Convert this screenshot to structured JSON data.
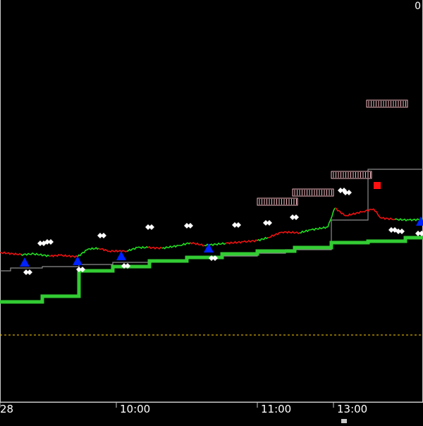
{
  "chart_data": {
    "type": "line",
    "title": "",
    "xlabel": "",
    "ylabel": "",
    "x_ticks": [
      "28",
      "10:00",
      "11:00",
      "13:00"
    ],
    "corner_text": "0",
    "background_color": "#000000",
    "frame_color": "#c8c8c8",
    "grid": false,
    "price_series": [
      {
        "x": 0,
        "y": 212,
        "dir": "down"
      },
      {
        "x": 30,
        "y": 209,
        "dir": "down"
      },
      {
        "x": 48,
        "y": 210,
        "dir": "up"
      },
      {
        "x": 70,
        "y": 207,
        "dir": "up"
      },
      {
        "x": 85,
        "y": 208,
        "dir": "down"
      },
      {
        "x": 110,
        "y": 206,
        "dir": "down"
      },
      {
        "x": 125,
        "y": 217,
        "dir": "up"
      },
      {
        "x": 140,
        "y": 218,
        "dir": "up"
      },
      {
        "x": 155,
        "y": 214,
        "dir": "down"
      },
      {
        "x": 180,
        "y": 214,
        "dir": "down"
      },
      {
        "x": 195,
        "y": 219,
        "dir": "up"
      },
      {
        "x": 210,
        "y": 219,
        "dir": "up"
      },
      {
        "x": 230,
        "y": 218,
        "dir": "down"
      },
      {
        "x": 255,
        "y": 222,
        "dir": "up"
      },
      {
        "x": 270,
        "y": 226,
        "dir": "up"
      },
      {
        "x": 290,
        "y": 222,
        "dir": "down"
      },
      {
        "x": 320,
        "y": 225,
        "dir": "up"
      },
      {
        "x": 345,
        "y": 227,
        "dir": "down"
      },
      {
        "x": 365,
        "y": 229,
        "dir": "down"
      },
      {
        "x": 380,
        "y": 233,
        "dir": "up"
      },
      {
        "x": 400,
        "y": 241,
        "dir": "down"
      },
      {
        "x": 425,
        "y": 240,
        "dir": "down"
      },
      {
        "x": 440,
        "y": 244,
        "dir": "up"
      },
      {
        "x": 465,
        "y": 248,
        "dir": "up"
      },
      {
        "x": 475,
        "y": 275,
        "dir": "up"
      },
      {
        "x": 490,
        "y": 264,
        "dir": "down"
      },
      {
        "x": 515,
        "y": 270,
        "dir": "down"
      },
      {
        "x": 530,
        "y": 274,
        "dir": "down"
      },
      {
        "x": 540,
        "y": 261,
        "dir": "down"
      },
      {
        "x": 560,
        "y": 259,
        "dir": "down"
      },
      {
        "x": 580,
        "y": 258,
        "dir": "up"
      },
      {
        "x": 600,
        "y": 259,
        "dir": "up"
      }
    ],
    "gray_step_series": [
      {
        "x": 0,
        "y": 186
      },
      {
        "x": 15,
        "y": 190
      },
      {
        "x": 60,
        "y": 192
      },
      {
        "x": 112,
        "y": 195
      },
      {
        "x": 160,
        "y": 198
      },
      {
        "x": 215,
        "y": 201
      },
      {
        "x": 265,
        "y": 205
      },
      {
        "x": 315,
        "y": 207
      },
      {
        "x": 365,
        "y": 211
      },
      {
        "x": 405,
        "y": 216
      },
      {
        "x": 470,
        "y": 258
      },
      {
        "x": 522,
        "y": 330
      },
      {
        "x": 575,
        "y": 330
      }
    ],
    "green_step_series": [
      {
        "x": 0,
        "y": 142
      },
      {
        "x": 60,
        "y": 150
      },
      {
        "x": 112,
        "y": 186
      },
      {
        "x": 160,
        "y": 192
      },
      {
        "x": 212,
        "y": 200
      },
      {
        "x": 265,
        "y": 205
      },
      {
        "x": 315,
        "y": 210
      },
      {
        "x": 365,
        "y": 214
      },
      {
        "x": 418,
        "y": 219
      },
      {
        "x": 470,
        "y": 226
      },
      {
        "x": 522,
        "y": 228
      },
      {
        "x": 575,
        "y": 233
      }
    ],
    "reference_line": {
      "y": 95,
      "color": "#ffd000",
      "style": "dashed"
    },
    "buy_markers": [
      {
        "x": 35,
        "y": 198
      },
      {
        "x": 110,
        "y": 200
      },
      {
        "x": 172,
        "y": 207
      },
      {
        "x": 296,
        "y": 218
      },
      {
        "x": 597,
        "y": 256
      }
    ],
    "sell_boxes": [
      {
        "x": 365,
        "y": 284,
        "w": 57
      },
      {
        "x": 415,
        "y": 297,
        "w": 58
      },
      {
        "x": 470,
        "y": 322,
        "w": 57
      },
      {
        "x": 520,
        "y": 423,
        "w": 58
      }
    ],
    "red_square": {
      "x": 535,
      "y": 307
    },
    "white_dots": [
      {
        "x": 57,
        "y": 225
      },
      {
        "x": 67,
        "y": 227
      },
      {
        "x": 142,
        "y": 236
      },
      {
        "x": 210,
        "y": 248
      },
      {
        "x": 265,
        "y": 250
      },
      {
        "x": 333,
        "y": 251
      },
      {
        "x": 377,
        "y": 254
      },
      {
        "x": 415,
        "y": 262
      },
      {
        "x": 483,
        "y": 300
      },
      {
        "x": 490,
        "y": 297
      },
      {
        "x": 555,
        "y": 244
      },
      {
        "x": 565,
        "y": 242
      },
      {
        "x": 593,
        "y": 239
      },
      {
        "x": 37,
        "y": 184
      },
      {
        "x": 112,
        "y": 188
      },
      {
        "x": 176,
        "y": 193
      },
      {
        "x": 300,
        "y": 204
      }
    ]
  }
}
